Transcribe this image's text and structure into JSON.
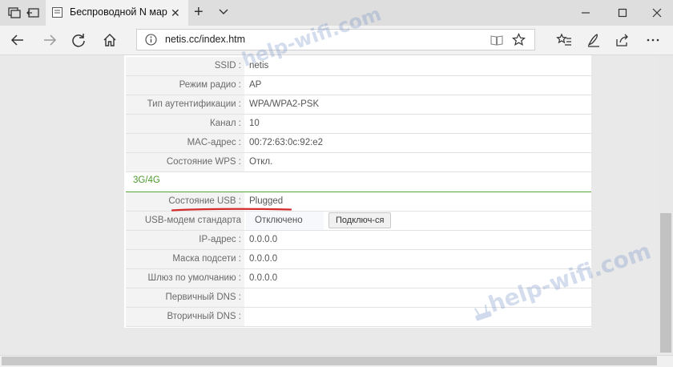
{
  "browser": {
    "tab_title": "Беспроводной N марш",
    "url": "netis.cc/index.htm"
  },
  "wireless": [
    {
      "label": "SSID :",
      "value": "netis"
    },
    {
      "label": "Режим радио :",
      "value": "AP"
    },
    {
      "label": "Тип аутентификации :",
      "value": "WPA/WPA2-PSK"
    },
    {
      "label": "Канал :",
      "value": "10"
    },
    {
      "label": "MAC-адрес :",
      "value": "00:72:63:0c:92:e2"
    },
    {
      "label": "Состояние WPS :",
      "value": "Откл."
    }
  ],
  "section_3g4g": {
    "title": "3G/4G",
    "usb_status": {
      "label": "Состояние USB :",
      "value": "Plugged"
    },
    "usb_modem": {
      "label": "USB-модем стандарта",
      "value": "Отключено",
      "button": "Подключ-ся"
    },
    "ip": {
      "label": "IP-адрес :",
      "value": "0.0.0.0"
    },
    "mask": {
      "label": "Маска подсети :",
      "value": "0.0.0.0"
    },
    "gateway": {
      "label": "Шлюз по умолчанию :",
      "value": "0.0.0.0"
    },
    "dns1": {
      "label": "Первичный DNS :",
      "value": ""
    },
    "dns2": {
      "label": "Вторичный DNS :",
      "value": ""
    }
  },
  "watermark": "help-wifi.com",
  "colors": {
    "section_accent": "#4a9a2a",
    "annotation": "#d42b2b"
  }
}
